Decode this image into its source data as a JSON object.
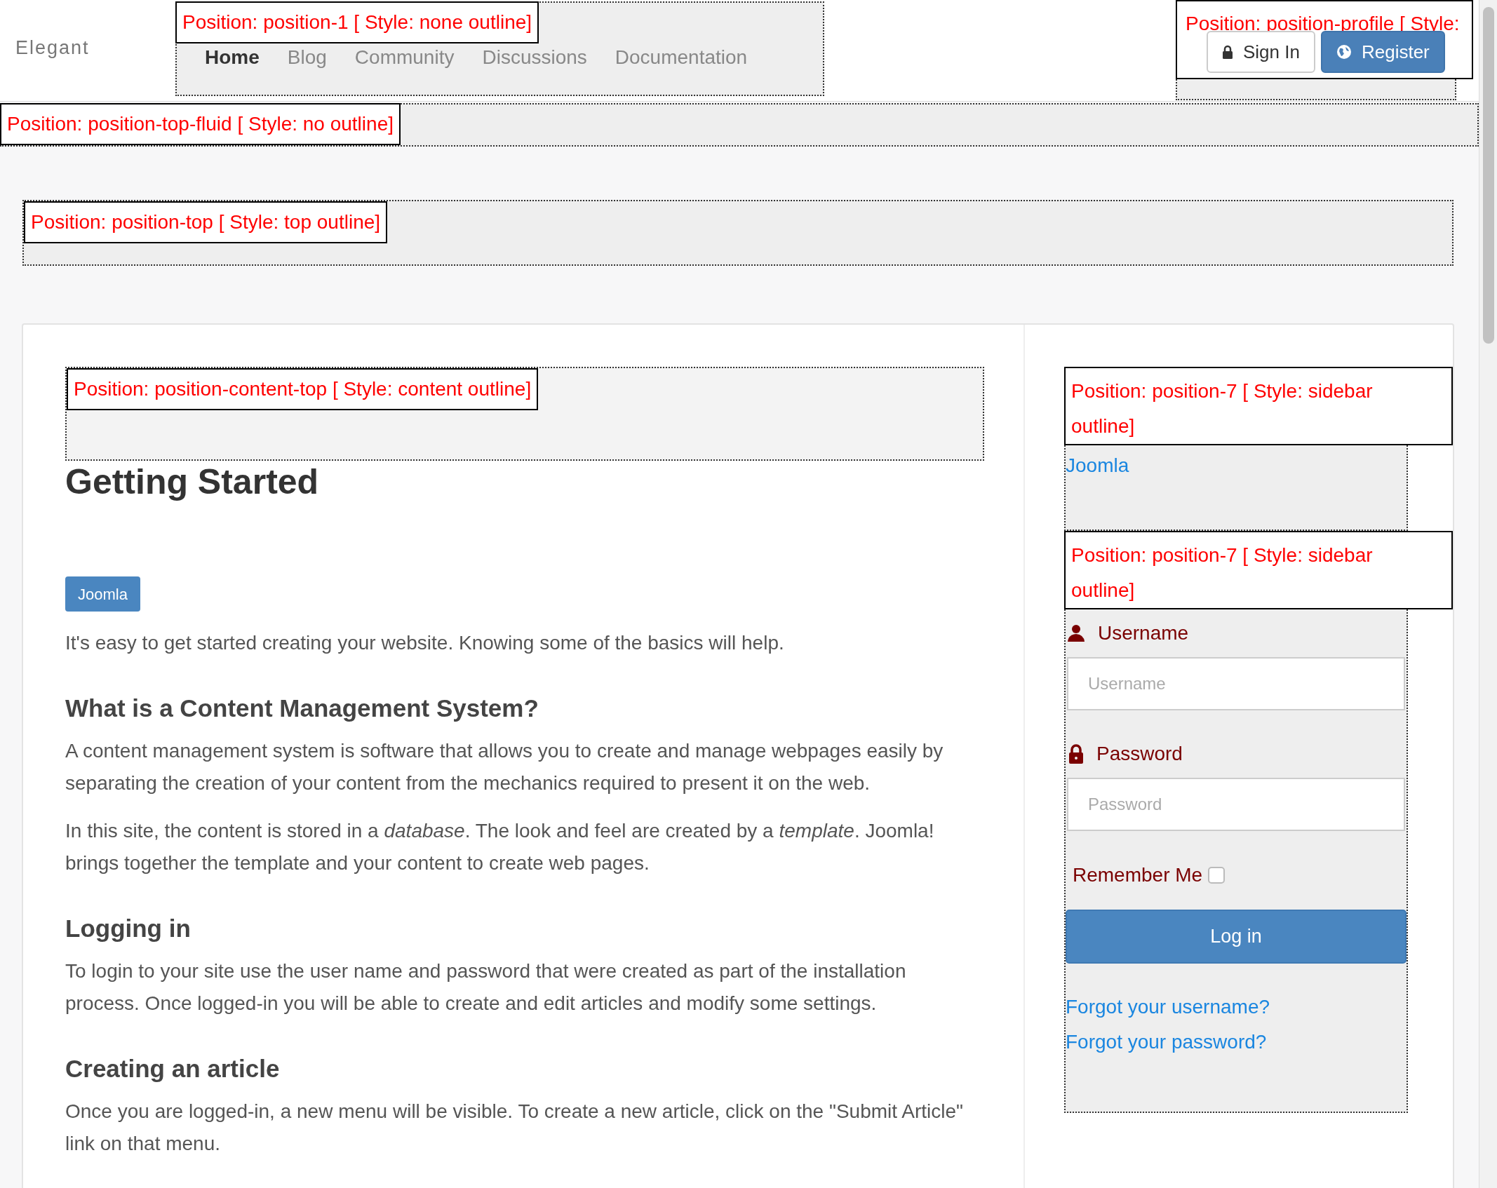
{
  "header": {
    "brand": "Elegant",
    "position_1": {
      "label": "Position: position-1 [ Style: none outline]",
      "nav": [
        {
          "label": "Home",
          "selected": true
        },
        {
          "label": "Blog",
          "selected": false
        },
        {
          "label": "Community",
          "selected": false
        },
        {
          "label": "Discussions",
          "selected": false
        },
        {
          "label": "Documentation",
          "selected": false
        }
      ]
    },
    "profile": {
      "label": "Position: position-profile [ Style:",
      "buttons": [
        {
          "label": "Sign In",
          "kind": "default"
        },
        {
          "label": "Register",
          "kind": "primary"
        }
      ]
    }
  },
  "top_fluid": {
    "label": "Position: position-top-fluid [ Style: no outline]"
  },
  "top": {
    "label": "Position: position-top [ Style: top outline]"
  },
  "content_top": {
    "label": "Position: position-content-top [ Style: content outline]"
  },
  "article": {
    "title": "Getting Started",
    "tag": "Joomla",
    "intro": "It's easy to get started creating your website. Knowing some of the basics will help.",
    "sections": [
      {
        "heading": "What is a Content Management System?",
        "paragraphs": [
          "A content management system is software that allows you to create and manage webpages easily by separating the creation of your content from the mechanics required to present it on the web.",
          "In this site, the content is stored in a *database*. The look and feel are created by a *template*. Joomla! brings together the template and your content to create web pages."
        ]
      },
      {
        "heading": "Logging in",
        "paragraphs": [
          "To login to your site use the user name and password that were created as part of the installation process. Once logged-in you will be able to create and edit articles and modify some settings."
        ]
      },
      {
        "heading": "Creating an article",
        "paragraphs": [
          "Once you are logged-in, a new menu will be visible. To create a new article, click on the \"Submit Article\" link on that menu."
        ]
      }
    ]
  },
  "sidebar": {
    "menu_module": {
      "label": "Position: position-7 [ Style: sidebar outline]",
      "links": [
        "Joomla"
      ]
    },
    "login_module": {
      "label": "Position: position-7 [ Style: sidebar outline]",
      "username_label": "Username",
      "username_placeholder": "Username",
      "password_label": "Password",
      "password_placeholder": "Password",
      "remember_label": "Remember Me",
      "remember_checked": false,
      "submit": "Log in",
      "links": [
        "Forgot your username?",
        "Forgot your password?"
      ]
    }
  }
}
